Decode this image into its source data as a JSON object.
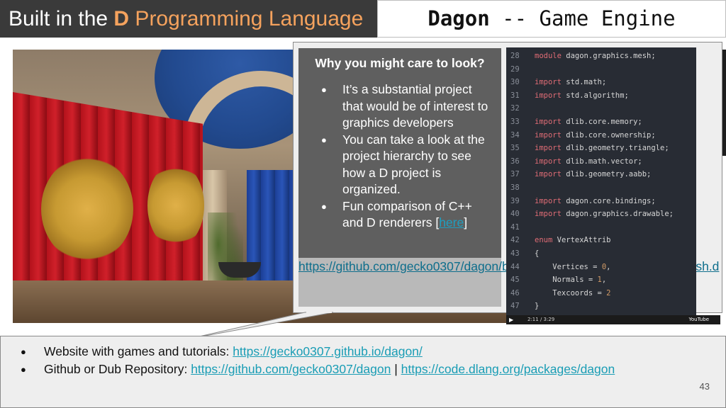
{
  "title": {
    "left_prefix": "Built in the ",
    "left_letter": "D",
    "left_suffix": " Programming Language",
    "right_name": "Dagon",
    "right_suffix": " -- Game Engine"
  },
  "callout": {
    "heading": "Why you might care to look?",
    "bullets": [
      "It’s a substantial project that would be of interest to graphics developers",
      "You can take a look at the project hierarchy to see how a D project is organized."
    ],
    "bullet3_text": "Fun comparison of C++ and D renderers [",
    "bullet3_link": "here",
    "bullet3_end": "]",
    "source_link": "https://github.com/gecko0307/dagon/blob/master/src/dagon/graphics/mesh.d"
  },
  "code": {
    "lines": [
      {
        "n": "28",
        "kw": "module",
        "rest": " dagon.graphics.mesh;"
      },
      {
        "n": "29",
        "kw": "",
        "rest": ""
      },
      {
        "n": "30",
        "kw": "import",
        "rest": " std.math;"
      },
      {
        "n": "31",
        "kw": "import",
        "rest": " std.algorithm;"
      },
      {
        "n": "32",
        "kw": "",
        "rest": ""
      },
      {
        "n": "33",
        "kw": "import",
        "rest": " dlib.core.memory;"
      },
      {
        "n": "34",
        "kw": "import",
        "rest": " dlib.core.ownership;"
      },
      {
        "n": "35",
        "kw": "import",
        "rest": " dlib.geometry.triangle;"
      },
      {
        "n": "36",
        "kw": "import",
        "rest": " dlib.math.vector;"
      },
      {
        "n": "37",
        "kw": "import",
        "rest": " dlib.geometry.aabb;"
      },
      {
        "n": "38",
        "kw": "",
        "rest": ""
      },
      {
        "n": "39",
        "kw": "import",
        "rest": " dagon.core.bindings;"
      },
      {
        "n": "40",
        "kw": "import",
        "rest": " dagon.graphics.drawable;"
      },
      {
        "n": "41",
        "kw": "",
        "rest": ""
      },
      {
        "n": "42",
        "kw": "enum",
        "rest": " VertexAttrib"
      },
      {
        "n": "43",
        "kw": "",
        "rest": "{"
      },
      {
        "n": "44",
        "kw": "",
        "rest": "    Vertices = 0,"
      },
      {
        "n": "45",
        "kw": "",
        "rest": "    Normals = 1,"
      },
      {
        "n": "46",
        "kw": "",
        "rest": "    Texcoords = 2"
      },
      {
        "n": "47",
        "kw": "",
        "rest": "}"
      }
    ],
    "video_time": "2:11 / 3:29",
    "video_brand": "YouTube"
  },
  "bottom": {
    "item1_label": "Website with games and tutorials: ",
    "item1_link": "https://gecko0307.github.io/dagon/",
    "item2_label": "Github or Dub Repository: ",
    "item2_link1": "https://github.com/gecko0307/dagon",
    "item2_sep": " | ",
    "item2_link2": "https://code.dlang.org/packages/dagon"
  },
  "page_number": "43",
  "colors": {
    "title_bg": "#3a3a3a",
    "title_accent": "#f5a25d",
    "info_bg": "#5f5f5f",
    "link": "#1a9db5",
    "code_bg": "#282c34",
    "code_keyword": "#e06c75"
  }
}
